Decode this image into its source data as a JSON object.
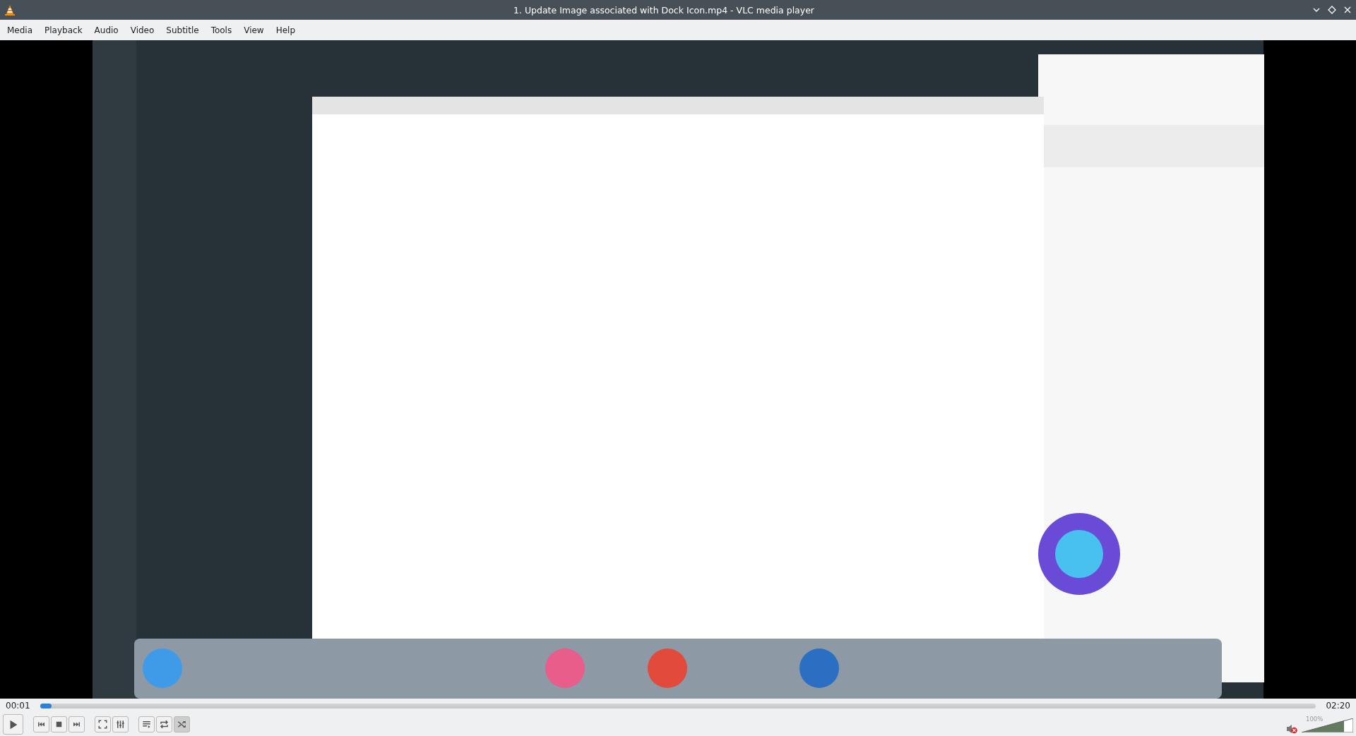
{
  "window": {
    "title": "1. Update Image associated with Dock Icon.mp4 - VLC media player"
  },
  "menu": [
    "Media",
    "Playback",
    "Audio",
    "Video",
    "Subtitle",
    "Tools",
    "View",
    "Help"
  ],
  "progress": {
    "elapsed": "00:01",
    "total": "02:20",
    "level": 0.008
  },
  "control_groups": [
    {
      "buttons": [
        {
          "kind": "play"
        }
      ]
    },
    {
      "buttons": [
        {
          "kind": "previous"
        },
        {
          "kind": "stop"
        },
        {
          "kind": "next"
        }
      ]
    },
    {
      "buttons": [
        {
          "kind": "fullscreen"
        },
        {
          "kind": "settings"
        }
      ]
    },
    {
      "buttons": [
        {
          "kind": "playlist"
        },
        {
          "kind": "loop",
          "selected": false
        },
        {
          "kind": "shuffle",
          "selected": true
        }
      ]
    }
  ],
  "volume": {
    "muted": true,
    "reading": "100%",
    "level": 0.82
  }
}
